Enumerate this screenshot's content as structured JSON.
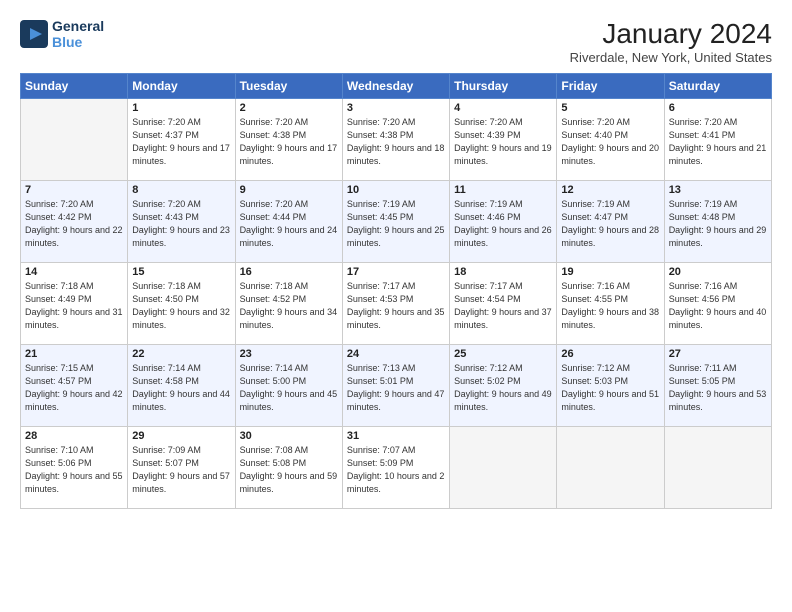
{
  "logo": {
    "line1": "General",
    "line2": "Blue",
    "icon": "▶"
  },
  "title": "January 2024",
  "subtitle": "Riverdale, New York, United States",
  "header": {
    "days": [
      "Sunday",
      "Monday",
      "Tuesday",
      "Wednesday",
      "Thursday",
      "Friday",
      "Saturday"
    ]
  },
  "weeks": [
    {
      "cells": [
        {
          "date": "",
          "empty": true
        },
        {
          "date": "1",
          "sunrise": "7:20 AM",
          "sunset": "4:37 PM",
          "daylight": "9 hours and 17 minutes."
        },
        {
          "date": "2",
          "sunrise": "7:20 AM",
          "sunset": "4:38 PM",
          "daylight": "9 hours and 17 minutes."
        },
        {
          "date": "3",
          "sunrise": "7:20 AM",
          "sunset": "4:38 PM",
          "daylight": "9 hours and 18 minutes."
        },
        {
          "date": "4",
          "sunrise": "7:20 AM",
          "sunset": "4:39 PM",
          "daylight": "9 hours and 19 minutes."
        },
        {
          "date": "5",
          "sunrise": "7:20 AM",
          "sunset": "4:40 PM",
          "daylight": "9 hours and 20 minutes."
        },
        {
          "date": "6",
          "sunrise": "7:20 AM",
          "sunset": "4:41 PM",
          "daylight": "9 hours and 21 minutes."
        }
      ]
    },
    {
      "cells": [
        {
          "date": "7",
          "sunrise": "7:20 AM",
          "sunset": "4:42 PM",
          "daylight": "9 hours and 22 minutes."
        },
        {
          "date": "8",
          "sunrise": "7:20 AM",
          "sunset": "4:43 PM",
          "daylight": "9 hours and 23 minutes."
        },
        {
          "date": "9",
          "sunrise": "7:20 AM",
          "sunset": "4:44 PM",
          "daylight": "9 hours and 24 minutes."
        },
        {
          "date": "10",
          "sunrise": "7:19 AM",
          "sunset": "4:45 PM",
          "daylight": "9 hours and 25 minutes."
        },
        {
          "date": "11",
          "sunrise": "7:19 AM",
          "sunset": "4:46 PM",
          "daylight": "9 hours and 26 minutes."
        },
        {
          "date": "12",
          "sunrise": "7:19 AM",
          "sunset": "4:47 PM",
          "daylight": "9 hours and 28 minutes."
        },
        {
          "date": "13",
          "sunrise": "7:19 AM",
          "sunset": "4:48 PM",
          "daylight": "9 hours and 29 minutes."
        }
      ]
    },
    {
      "cells": [
        {
          "date": "14",
          "sunrise": "7:18 AM",
          "sunset": "4:49 PM",
          "daylight": "9 hours and 31 minutes."
        },
        {
          "date": "15",
          "sunrise": "7:18 AM",
          "sunset": "4:50 PM",
          "daylight": "9 hours and 32 minutes."
        },
        {
          "date": "16",
          "sunrise": "7:18 AM",
          "sunset": "4:52 PM",
          "daylight": "9 hours and 34 minutes."
        },
        {
          "date": "17",
          "sunrise": "7:17 AM",
          "sunset": "4:53 PM",
          "daylight": "9 hours and 35 minutes."
        },
        {
          "date": "18",
          "sunrise": "7:17 AM",
          "sunset": "4:54 PM",
          "daylight": "9 hours and 37 minutes."
        },
        {
          "date": "19",
          "sunrise": "7:16 AM",
          "sunset": "4:55 PM",
          "daylight": "9 hours and 38 minutes."
        },
        {
          "date": "20",
          "sunrise": "7:16 AM",
          "sunset": "4:56 PM",
          "daylight": "9 hours and 40 minutes."
        }
      ]
    },
    {
      "cells": [
        {
          "date": "21",
          "sunrise": "7:15 AM",
          "sunset": "4:57 PM",
          "daylight": "9 hours and 42 minutes."
        },
        {
          "date": "22",
          "sunrise": "7:14 AM",
          "sunset": "4:58 PM",
          "daylight": "9 hours and 44 minutes."
        },
        {
          "date": "23",
          "sunrise": "7:14 AM",
          "sunset": "5:00 PM",
          "daylight": "9 hours and 45 minutes."
        },
        {
          "date": "24",
          "sunrise": "7:13 AM",
          "sunset": "5:01 PM",
          "daylight": "9 hours and 47 minutes."
        },
        {
          "date": "25",
          "sunrise": "7:12 AM",
          "sunset": "5:02 PM",
          "daylight": "9 hours and 49 minutes."
        },
        {
          "date": "26",
          "sunrise": "7:12 AM",
          "sunset": "5:03 PM",
          "daylight": "9 hours and 51 minutes."
        },
        {
          "date": "27",
          "sunrise": "7:11 AM",
          "sunset": "5:05 PM",
          "daylight": "9 hours and 53 minutes."
        }
      ]
    },
    {
      "cells": [
        {
          "date": "28",
          "sunrise": "7:10 AM",
          "sunset": "5:06 PM",
          "daylight": "9 hours and 55 minutes."
        },
        {
          "date": "29",
          "sunrise": "7:09 AM",
          "sunset": "5:07 PM",
          "daylight": "9 hours and 57 minutes."
        },
        {
          "date": "30",
          "sunrise": "7:08 AM",
          "sunset": "5:08 PM",
          "daylight": "9 hours and 59 minutes."
        },
        {
          "date": "31",
          "sunrise": "7:07 AM",
          "sunset": "5:09 PM",
          "daylight": "10 hours and 2 minutes."
        },
        {
          "date": "",
          "empty": true
        },
        {
          "date": "",
          "empty": true
        },
        {
          "date": "",
          "empty": true
        }
      ]
    }
  ],
  "labels": {
    "sunrise": "Sunrise:",
    "sunset": "Sunset:",
    "daylight": "Daylight:"
  }
}
